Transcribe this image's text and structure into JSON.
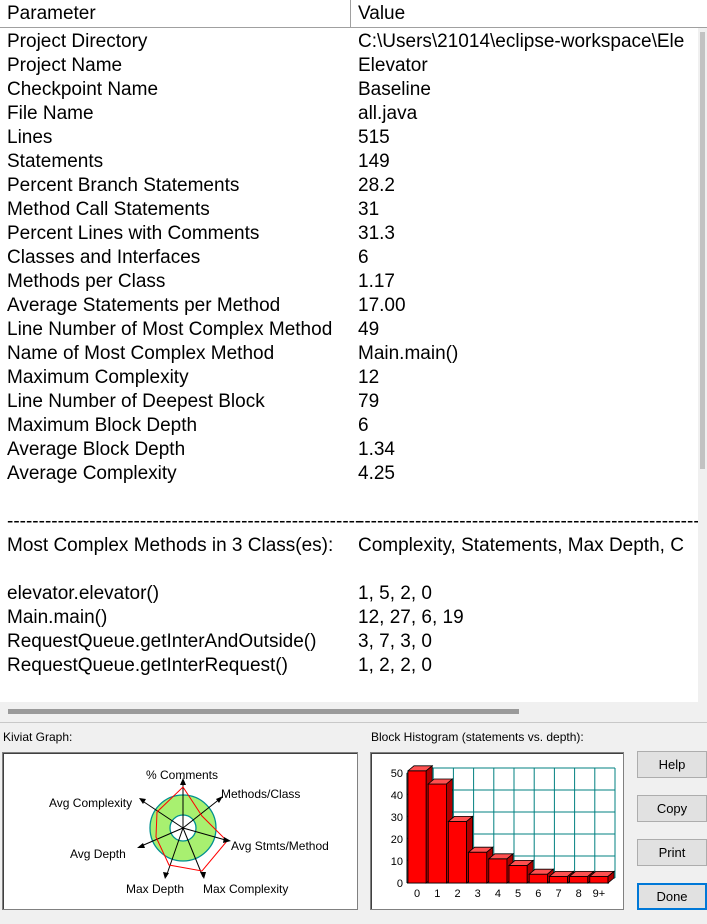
{
  "table": {
    "headers": {
      "parameter": "Parameter",
      "value": "Value"
    },
    "rows": [
      [
        "Project Directory",
        "C:\\Users\\21014\\eclipse-workspace\\Ele"
      ],
      [
        "Project Name",
        "Elevator"
      ],
      [
        "Checkpoint Name",
        "Baseline"
      ],
      [
        "File Name",
        "all.java"
      ],
      [
        "Lines",
        "515"
      ],
      [
        "Statements",
        "149"
      ],
      [
        "Percent Branch Statements",
        "28.2"
      ],
      [
        "Method Call Statements",
        "31"
      ],
      [
        "Percent Lines with Comments",
        "31.3"
      ],
      [
        "Classes and Interfaces",
        "6"
      ],
      [
        "Methods per Class",
        "1.17"
      ],
      [
        "Average Statements per Method",
        "17.00"
      ],
      [
        "Line Number of Most Complex Method",
        "49"
      ],
      [
        "Name of Most Complex Method",
        "Main.main()"
      ],
      [
        "Maximum Complexity",
        "12"
      ],
      [
        "Line Number of Deepest Block",
        "79"
      ],
      [
        "Maximum Block Depth",
        "6"
      ],
      [
        "Average Block Depth",
        "1.34"
      ],
      [
        "Average Complexity",
        "4.25"
      ],
      [
        "",
        ""
      ],
      [
        "--------------------------------------------------------",
        "------------------------------------------------------"
      ],
      [
        "Most Complex Methods in 3 Class(es):",
        "Complexity, Statements, Max Depth, C"
      ],
      [
        "",
        ""
      ],
      [
        "elevator.elevator()",
        "1, 5, 2, 0"
      ],
      [
        "Main.main()",
        "12, 27, 6, 19"
      ],
      [
        "RequestQueue.getInterAndOutside()",
        "3, 7, 3, 0"
      ],
      [
        "RequestQueue.getInterRequest()",
        "1, 2, 2, 0"
      ]
    ]
  },
  "kiviat": {
    "label": "Kiviat Graph:",
    "axes": {
      "comments": "% Comments",
      "methods_class": "Methods/Class",
      "avg_stmts": "Avg Stmts/Method",
      "max_complexity": "Max Complexity",
      "max_depth": "Max Depth",
      "avg_depth": "Avg Depth",
      "avg_complexity": "Avg Complexity"
    },
    "colors": {
      "band": "#a8f070",
      "outline": "#009090",
      "polygon": "#ff0000"
    }
  },
  "histogram": {
    "label": "Block Histogram (statements vs. depth):",
    "chart_data": {
      "type": "bar",
      "categories": [
        "0",
        "1",
        "2",
        "3",
        "4",
        "5",
        "6",
        "7",
        "8",
        "9+"
      ],
      "values": [
        51,
        45,
        28,
        14,
        11,
        8,
        4,
        3,
        3,
        3
      ],
      "ylim": [
        0,
        50
      ],
      "yticks": [
        "50",
        "40",
        "30",
        "20",
        "10",
        "0"
      ],
      "grid": true,
      "bar_color": "#ff0000",
      "grid_color": "#008080"
    }
  },
  "buttons": {
    "help": "Help",
    "copy": "Copy",
    "print": "Print",
    "done": "Done"
  }
}
